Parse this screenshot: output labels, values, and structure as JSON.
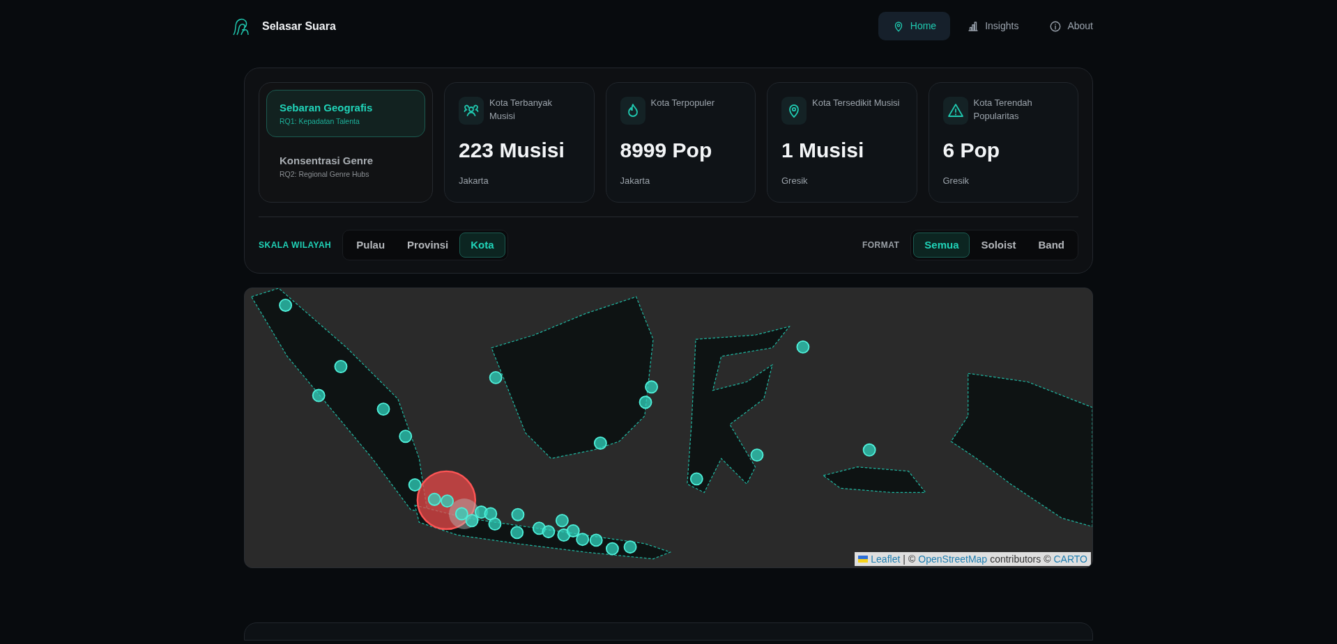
{
  "brand": {
    "name": "Selasar Suara"
  },
  "nav": [
    {
      "label": "Home",
      "selected": true
    },
    {
      "label": "Insights",
      "selected": false
    },
    {
      "label": "About",
      "selected": false
    }
  ],
  "modes": [
    {
      "title": "Sebaran Geografis",
      "subtitle": "RQ1: Kepadatan Talenta",
      "selected": true
    },
    {
      "title": "Konsentrasi Genre",
      "subtitle": "RQ2: Regional Genre Hubs",
      "selected": false
    }
  ],
  "stats": [
    {
      "label": "Kota Terbanyak Musisi",
      "value": "223 Musisi",
      "city": "Jakarta"
    },
    {
      "label": "Kota Terpopuler",
      "value": "8999 Pop",
      "city": "Jakarta"
    },
    {
      "label": "Kota Tersedikit Musisi",
      "value": "1 Musisi",
      "city": "Gresik"
    },
    {
      "label": "Kota Terendah Popularitas",
      "value": "6 Pop",
      "city": "Gresik"
    }
  ],
  "scale": {
    "label": "SKALA WILAYAH",
    "options": [
      {
        "label": "Pulau",
        "selected": false
      },
      {
        "label": "Provinsi",
        "selected": false
      },
      {
        "label": "Kota",
        "selected": true
      }
    ]
  },
  "format": {
    "label": "FORMAT",
    "options": [
      {
        "label": "Semua",
        "selected": true
      },
      {
        "label": "Soloist",
        "selected": false
      },
      {
        "label": "Band",
        "selected": false
      }
    ]
  },
  "map": {
    "attribution": [
      {
        "text": "Leaflet",
        "link": true
      },
      {
        "text": "|",
        "link": false
      },
      {
        "text": "©",
        "link": false
      },
      {
        "text": "OpenStreetMap",
        "link": true
      },
      {
        "text": "contributors ©",
        "link": false
      },
      {
        "text": "CARTO",
        "link": true
      }
    ]
  }
}
